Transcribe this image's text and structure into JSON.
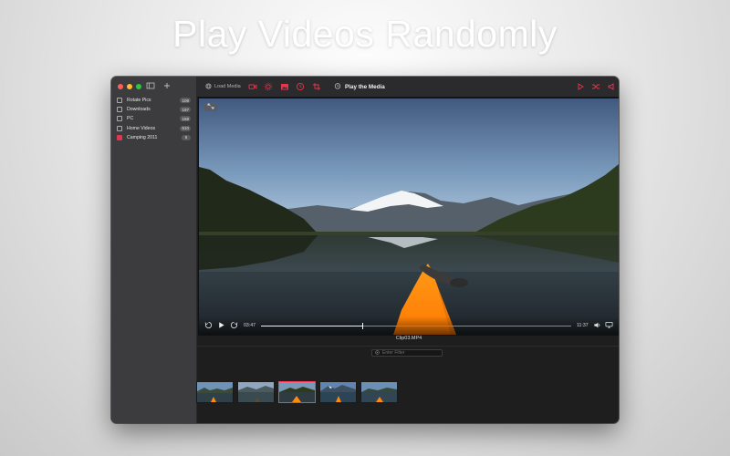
{
  "headline": "Play Videos Randomly",
  "window": {
    "traffic_lights": [
      "#ff5f57",
      "#febc2e",
      "#28c840"
    ],
    "sidebar": {
      "top_icons": [
        "sidebar-toggle-icon",
        "plus-icon"
      ],
      "items": [
        {
          "label": "Rotate Pics",
          "count": "108",
          "checked": false
        },
        {
          "label": "Downloads",
          "count": "197",
          "checked": false
        },
        {
          "label": "PC",
          "count": "158",
          "checked": false
        },
        {
          "label": "Home Videos",
          "count": "610",
          "checked": false
        },
        {
          "label": "Camping 2011",
          "count": "5",
          "checked": true
        }
      ]
    },
    "toolbar": {
      "load_label": "Load Media",
      "title": "Play the Media",
      "accent": "#e6364e"
    },
    "player": {
      "current_time": "03:47",
      "total_time": "11:37",
      "progress": 0.326,
      "filename": "Clip03.MP4"
    },
    "filter": {
      "placeholder": "Enter Filter"
    },
    "thumbnails": [
      {
        "selected": false
      },
      {
        "selected": false
      },
      {
        "selected": true
      },
      {
        "selected": false
      },
      {
        "selected": false
      }
    ]
  }
}
